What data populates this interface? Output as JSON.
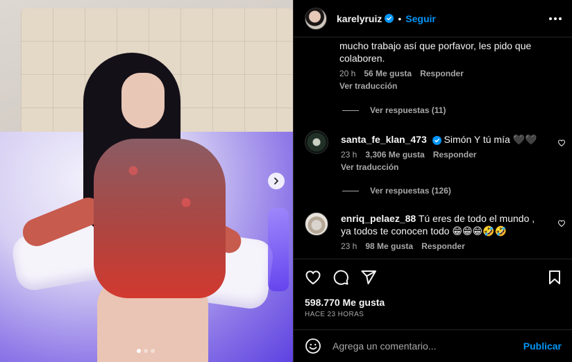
{
  "post": {
    "username": "karelyruiz",
    "separator": "•",
    "follow_label": "Seguir"
  },
  "comments": {
    "first": {
      "text": "mucho trabajo así que porfavor, les pido que colaboren.",
      "time": "20 h",
      "likes": "56 Me gusta",
      "reply": "Responder",
      "translate": "Ver traducción",
      "view_replies": "Ver respuestas (11)"
    },
    "second": {
      "user": "santa_fe_klan_473",
      "text": "Simón Y tú mía 🖤🖤",
      "time": "23 h",
      "likes": "3,306 Me gusta",
      "reply": "Responder",
      "translate": "Ver traducción",
      "view_replies": "Ver respuestas (126)"
    },
    "third": {
      "user": "enriq_pelaez_88",
      "text": "Tú eres de todo el mundo , ya todos te conocen todo 😁😁😁🤣🤣",
      "time": "23 h",
      "likes": "98 Me gusta",
      "reply": "Responder"
    }
  },
  "stats": {
    "likes": "598.770 Me gusta",
    "posted": "HACE 23 HORAS"
  },
  "composer": {
    "placeholder": "Agrega un comentario...",
    "publish_label": "Publicar"
  },
  "carousel": {
    "slides": 3,
    "active_slide": 1
  },
  "icons": {
    "heart": "heart-icon",
    "comment": "comment-icon",
    "share": "share-icon",
    "save": "bookmark-icon",
    "more": "more-icon",
    "emoji": "emoji-icon",
    "next": "chevron-right-icon"
  },
  "colors": {
    "accent": "#0095f6",
    "muted": "#a8a8a8"
  }
}
